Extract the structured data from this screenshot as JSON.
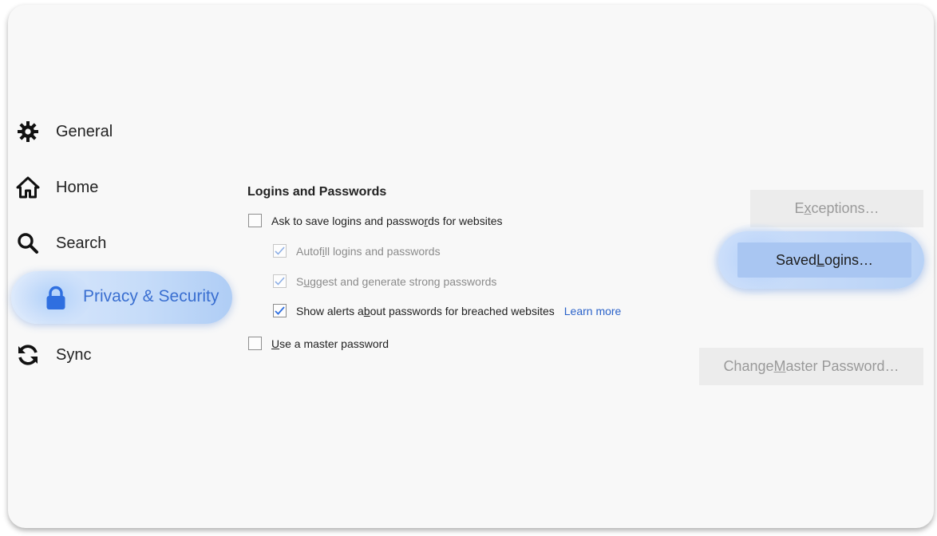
{
  "sidebar": {
    "items": [
      {
        "label": "General",
        "icon": "gear-icon"
      },
      {
        "label": "Home",
        "icon": "home-icon"
      },
      {
        "label": "Search",
        "icon": "search-icon"
      },
      {
        "label": "Privacy & Security",
        "icon": "lock-icon",
        "active": true
      },
      {
        "label": "Sync",
        "icon": "sync-icon"
      }
    ]
  },
  "logins": {
    "title": "Logins and Passwords",
    "ask_save": {
      "label_pre": "Ask to save logins and passwo",
      "label_key": "r",
      "label_post": "ds for websites",
      "checked": false
    },
    "autofill": {
      "label_pre": "Autof",
      "label_key": "i",
      "label_post": "ll logins and passwords",
      "checked": true,
      "disabled": true
    },
    "suggest": {
      "label_pre": "S",
      "label_key": "u",
      "label_post": "ggest and generate strong passwords",
      "checked": true,
      "disabled": true
    },
    "breach_alerts": {
      "label_pre": "Show alerts a",
      "label_key": "b",
      "label_post": "out passwords for breached websites",
      "checked": true
    },
    "learn_more": "Learn more",
    "master_password": {
      "label_pre": "",
      "label_key": "U",
      "label_post": "se a master password",
      "checked": false
    }
  },
  "buttons": {
    "exceptions": {
      "pre": "E",
      "key": "x",
      "post": "ceptions…",
      "disabled": true
    },
    "saved_logins": {
      "pre": "Saved ",
      "key": "L",
      "post": "ogins…"
    },
    "change_master": {
      "pre": "Change ",
      "key": "M",
      "post": "aster Password…",
      "disabled": true
    }
  },
  "colors": {
    "accent": "#3a6fd1",
    "link": "#2a62c9",
    "highlight": "#c6dcf9"
  }
}
